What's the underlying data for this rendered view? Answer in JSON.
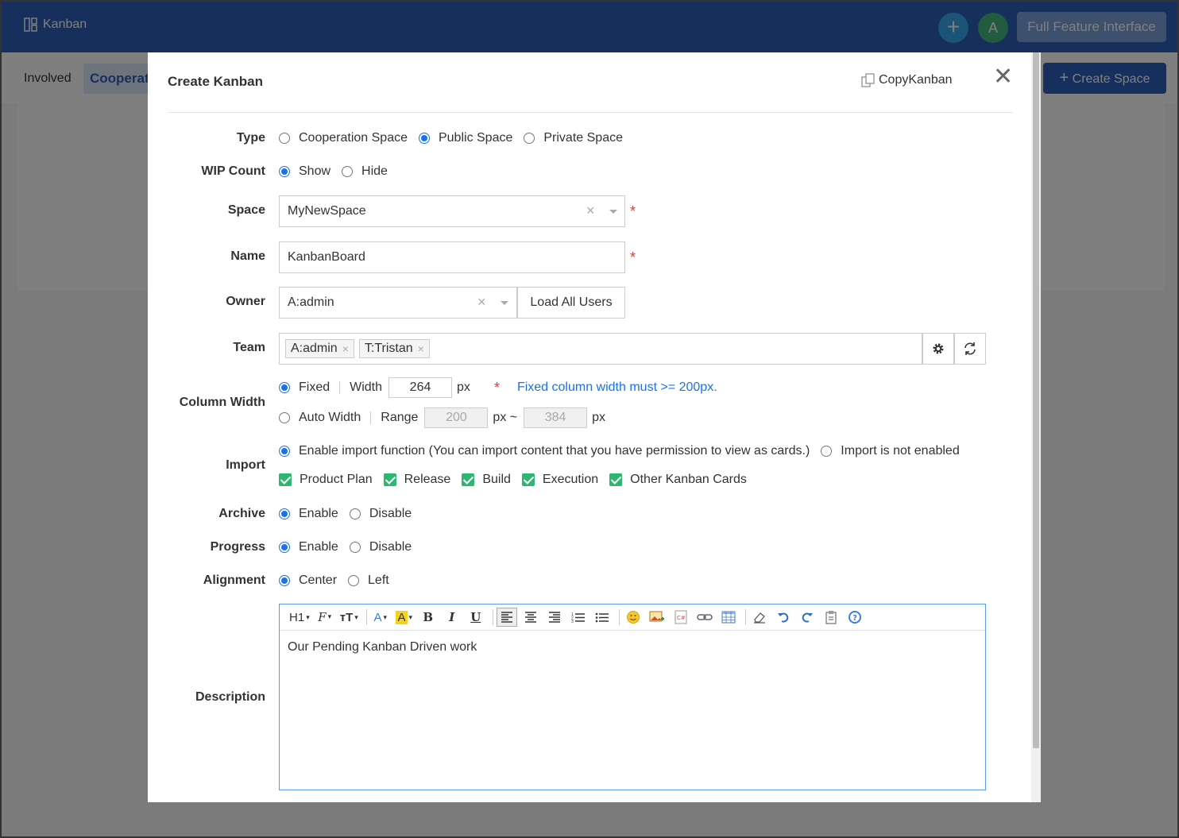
{
  "app": {
    "brand": "Kanban",
    "full_feature_label": "Full Feature Interface",
    "avatar_letter": "A",
    "plus_glyph": "+"
  },
  "tabs": {
    "involved": "Involved",
    "cooperation": "Cooperat",
    "create_space": "Create Space"
  },
  "modal": {
    "title": "Create Kanban",
    "copy_label": "CopyKanban",
    "close_glyph": "✕",
    "fields": {
      "type": {
        "label": "Type",
        "options": [
          "Cooperation Space",
          "Public Space",
          "Private Space"
        ],
        "selected": "Public Space"
      },
      "wip": {
        "label": "WIP Count",
        "options": [
          "Show",
          "Hide"
        ],
        "selected": "Show"
      },
      "space": {
        "label": "Space",
        "value": "MyNewSpace"
      },
      "name": {
        "label": "Name",
        "value": "KanbanBoard"
      },
      "owner": {
        "label": "Owner",
        "value": "A:admin",
        "load_button": "Load All Users"
      },
      "team": {
        "label": "Team",
        "tags": [
          "A:admin",
          "T:Tristan"
        ]
      },
      "column_width": {
        "label": "Column Width",
        "fixed_label": "Fixed",
        "width_label": "Width",
        "width_value": "264",
        "unit": "px",
        "hint": "Fixed column width must >= 200px.",
        "auto_label": "Auto Width",
        "range_label": "Range",
        "range_min": "200",
        "range_sep": "px ~",
        "range_max": "384",
        "selected": "Fixed"
      },
      "import": {
        "label": "Import",
        "enable_label": "Enable import function (You can import content that you have permission to view as cards.)",
        "disable_label": "Import is not enabled",
        "selected": "enable",
        "checks": [
          "Product Plan",
          "Release",
          "Build",
          "Execution",
          "Other Kanban Cards"
        ]
      },
      "archive": {
        "label": "Archive",
        "options": [
          "Enable",
          "Disable"
        ],
        "selected": "Enable"
      },
      "progress": {
        "label": "Progress",
        "options": [
          "Enable",
          "Disable"
        ],
        "selected": "Enable"
      },
      "alignment": {
        "label": "Alignment",
        "options": [
          "Center",
          "Left"
        ],
        "selected": "Center"
      },
      "description": {
        "label": "Description",
        "content": "Our Pending Kanban Driven work",
        "toolbar": [
          "H1",
          "F",
          "тT",
          "A",
          "A",
          "B",
          "I",
          "U"
        ]
      }
    },
    "required_mark": "*",
    "clear_glyph": "×"
  },
  "colors": {
    "primary": "#2c5fb8",
    "accent_blue": "#1a73e8",
    "check_green": "#2db871",
    "required_red": "#e33333"
  }
}
